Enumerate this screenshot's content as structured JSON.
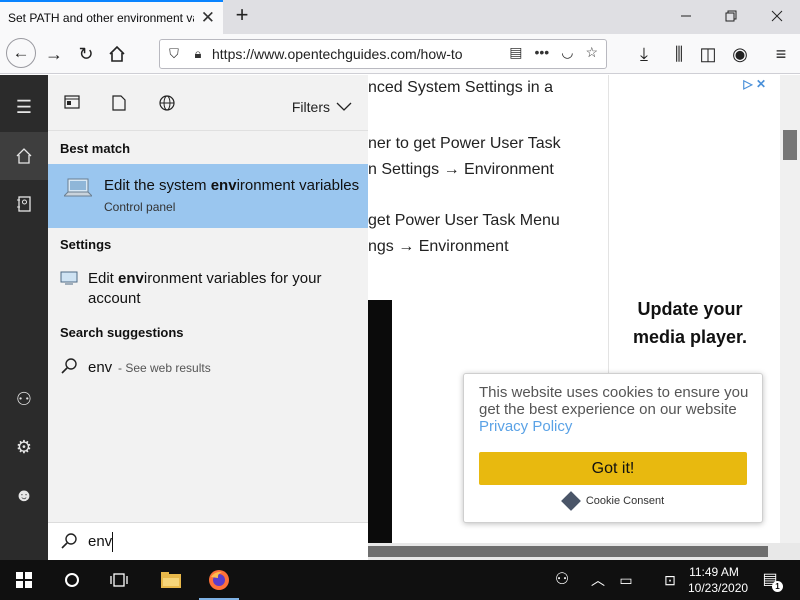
{
  "browser": {
    "tab_title": "Set PATH and other environment va",
    "tab_close": "✕",
    "new_tab": "+",
    "window_controls": [
      "minimize",
      "restore",
      "close"
    ],
    "url": "https://www.opentechguides.com/how-to",
    "nav_icons": [
      "back-icon",
      "forward-icon",
      "reload-icon",
      "home-icon"
    ],
    "toolbar_icons": [
      "download-icon",
      "library-icon",
      "sidebar-icon",
      "account-icon",
      "menu-icon"
    ]
  },
  "article": {
    "lines": [
      "nced System Settings in a",
      "ner to get Power User Task",
      "n Settings → Environment",
      "get Power User Task Menu",
      "ngs → Environment"
    ]
  },
  "ad": {
    "text_line1": "Update your",
    "text_line2": "media player."
  },
  "cookie": {
    "message": "This website uses cookies to ensure you get the best experience on our website",
    "link": "Privacy Policy",
    "button": "Got it!",
    "brand": "Cookie Consent",
    "button_color": "#e8b90f"
  },
  "start_menu": {
    "filters_label": "Filters",
    "best_match_heading": "Best match",
    "best_match": {
      "title_pre": "Edit the system ",
      "title_bold": "env",
      "title_post": "ironment variables",
      "subtitle": "Control panel",
      "highlight_color": "#9ac6ef"
    },
    "settings_heading": "Settings",
    "setting_item": {
      "pre": "Edit ",
      "bold": "env",
      "post": "ironment variables for your account"
    },
    "suggestions_heading": "Search suggestions",
    "suggestion": {
      "term": "env",
      "sub": "- See web results"
    },
    "search_value": "env"
  },
  "taskbar": {
    "time": "11:49 AM",
    "date": "10/23/2020",
    "notification_count": "1"
  }
}
